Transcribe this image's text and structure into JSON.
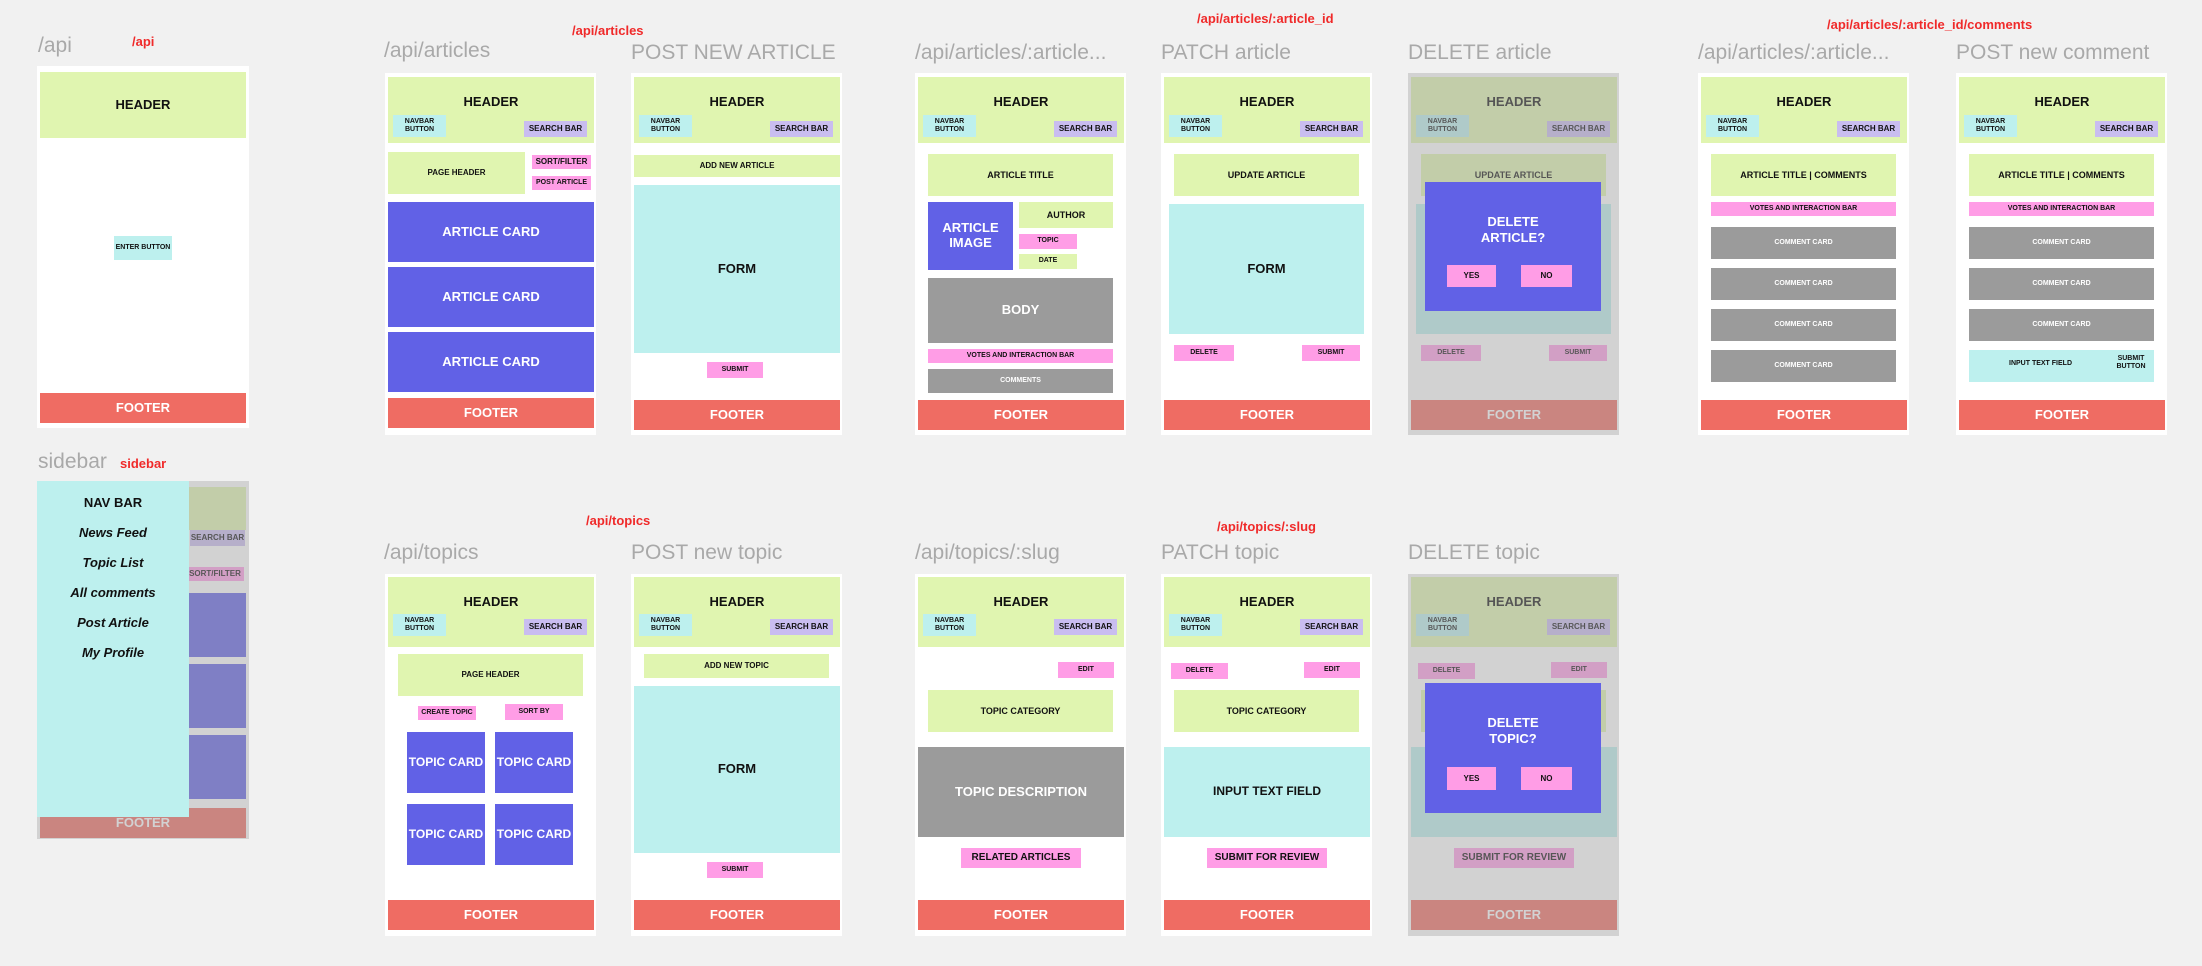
{
  "routes": {
    "api": "/api",
    "articles": "/api/articles",
    "article_id": "/api/articles/:article_id",
    "comments": "/api/articles/:article_id/comments",
    "sidebar": "sidebar",
    "topics": "/api/topics",
    "topics_slug": "/api/topics/:slug"
  },
  "frames": {
    "api": "/api",
    "articles": "/api/articles",
    "post_article": "POST NEW ARTICLE",
    "article": "/api/articles/:article...",
    "patch_article": "PATCH article",
    "delete_article": "DELETE article",
    "comments": "/api/articles/:article...",
    "post_comment": "POST new comment",
    "sidebar": "sidebar",
    "topics": "/api/topics",
    "post_topic": "POST new topic",
    "topic_slug": "/api/topics/:slug",
    "patch_topic": "PATCH topic",
    "delete_topic": "DELETE topic"
  },
  "ui": {
    "header": "HEADER",
    "footer": "FOOTER",
    "navbar_button": "NAVBAR BUTTON",
    "search_bar": "SEARCH BAR",
    "enter_button": "ENTER BUTTON",
    "page_header": "PAGE HEADER",
    "sort_filter": "SORT/FILTER",
    "post_article": "POST ARTICLE",
    "article_card": "ARTICLE CARD",
    "add_new_article": "ADD NEW ARTICLE",
    "form": "FORM",
    "submit": "SUBMIT",
    "article_title": "ARTICLE TITLE",
    "article_image": "ARTICLE IMAGE",
    "author": "AUTHOR",
    "topic": "TOPIC",
    "date": "DATE",
    "body": "BODY",
    "votes_bar": "VOTES AND INTERACTION BAR",
    "comments": "COMMENTS",
    "update_article": "UPDATE ARTICLE",
    "delete": "DELETE",
    "delete_article_q": "DELETE ARTICLE?",
    "yes": "YES",
    "no": "NO",
    "title_comments": "ARTICLE TITLE | COMMENTS",
    "comment_card": "COMMENT CARD",
    "input_text_field_small": "INPUT TEXT FIELD",
    "submit_button": "SUBMIT BUTTON",
    "create_topic": "CREATE TOPIC",
    "sort_by": "SORT BY",
    "topic_card": "TOPIC CARD",
    "add_new_topic": "ADD NEW TOPIC",
    "edit": "EDIT",
    "topic_category": "TOPIC CATEGORY",
    "topic_description": "TOPIC DESCRIPTION",
    "related_articles": "RELATED ARTICLES",
    "input_text_field": "INPUT TEXT FIELD",
    "submit_for_review": "SUBMIT FOR REVIEW",
    "delete_topic_q": "DELETE TOPIC?"
  },
  "sidebar": {
    "title": "NAV BAR",
    "items": [
      "News Feed",
      "Topic List",
      "All comments",
      "Post Article",
      "My Profile"
    ]
  },
  "colors": {
    "header": "#e0f5b0",
    "footer": "#ef6c63",
    "card": "#6161e6",
    "cyan": "#bdf0ee",
    "pink": "#ff9de6",
    "lavender": "#c9bdf0",
    "gray": "#9b9b9b",
    "route_label": "#f02a2a"
  }
}
